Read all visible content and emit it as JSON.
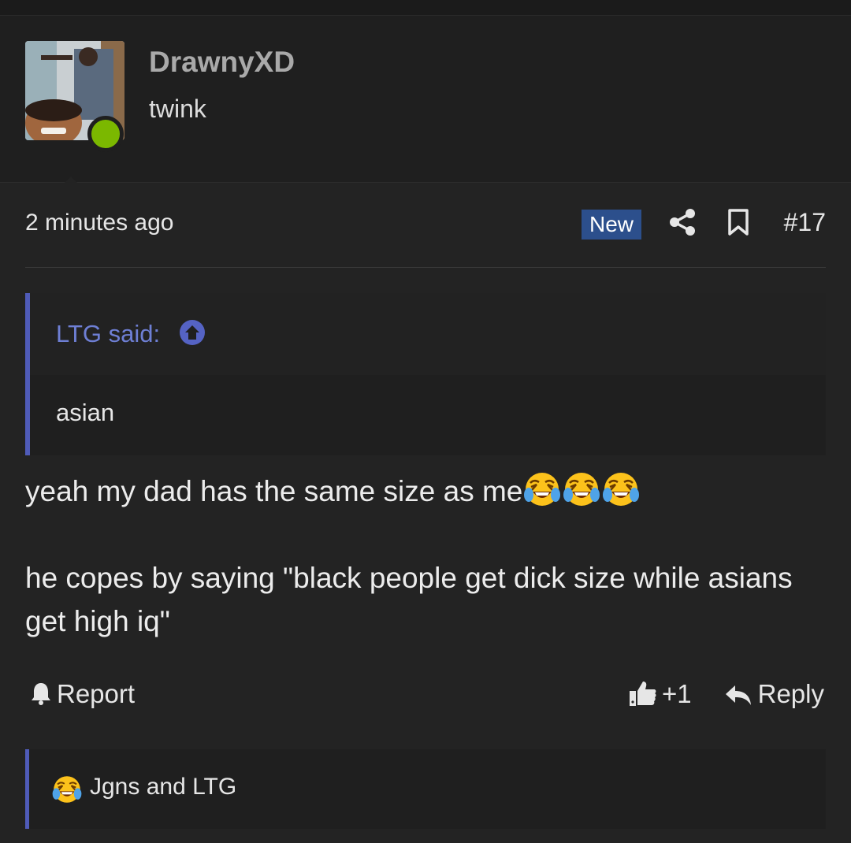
{
  "user": {
    "name": "DrawnyXD",
    "title": "twink"
  },
  "post": {
    "time": "2 minutes ago",
    "badge": "New",
    "number": "#17"
  },
  "quote": {
    "author": "LTG said:",
    "text": "asian"
  },
  "message": {
    "line1": "yeah my dad has the same size as me",
    "line2": "he copes by saying \"black people get dick size while asians get high iq\""
  },
  "actions": {
    "report": "Report",
    "likes": "+1",
    "reply": "Reply"
  },
  "reactions": {
    "text": "Jgns and LTG"
  },
  "icons": {
    "emoji": "laughing-crying-emoji",
    "share": "share-icon",
    "bookmark": "bookmark-icon",
    "quote_jump": "arrow-up-circle-icon",
    "report": "bell-icon",
    "like": "thumbs-up-icon",
    "reply": "reply-arrow-icon"
  },
  "colors": {
    "accent": "#4f5bb8",
    "quote_author": "#6e7fd4",
    "new_badge": "#2c4f8c",
    "online": "#7bb800"
  }
}
